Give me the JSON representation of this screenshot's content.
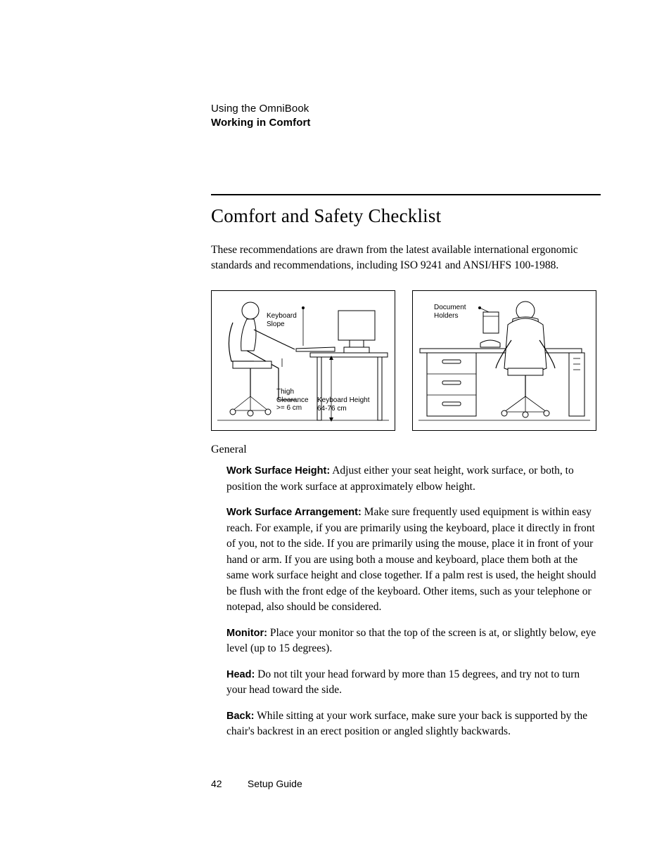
{
  "header": {
    "chapter": "Using the OmniBook",
    "section": "Working in Comfort"
  },
  "title": "Comfort and Safety Checklist",
  "intro": "These recommendations are drawn from the latest available international ergonomic standards and recommendations, including ISO 9241 and ANSI/HFS 100-1988.",
  "figure": {
    "left": {
      "keyboard_slope": "Keyboard\nSlope",
      "thigh_clearance": "Thigh\nClearance\n>= 6 cm",
      "keyboard_height": "Keyboard Height\n64-76 cm"
    },
    "right": {
      "document_holders": "Document\nHolders"
    }
  },
  "subhead": "General",
  "items": [
    {
      "lead": "Work Surface Height:",
      "body": " Adjust either your seat height, work surface, or both, to position the work surface at approximately elbow height."
    },
    {
      "lead": "Work Surface Arrangement:",
      "body": " Make sure frequently used equipment is within easy reach. For example, if you are primarily using the keyboard, place it directly in front of you, not to the side. If you are primarily using the mouse, place it in front of your hand or arm. If you are using both a mouse and keyboard, place them both at the same work surface height and close together. If a palm rest is used, the height should be flush with the front edge of the keyboard. Other items, such as your telephone or notepad, also should be considered."
    },
    {
      "lead": "Monitor:",
      "body": " Place your monitor so that the top of the screen is at, or slightly below, eye level (up to 15 degrees)."
    },
    {
      "lead": "Head:",
      "body": " Do not tilt your head forward by more than 15 degrees, and try not to turn your head toward the side."
    },
    {
      "lead": "Back:",
      "body": " While sitting at your work surface, make sure your back is supported by the chair's backrest in an erect position or angled slightly backwards."
    }
  ],
  "footer": {
    "page_number": "42",
    "doc_title": "Setup Guide"
  }
}
